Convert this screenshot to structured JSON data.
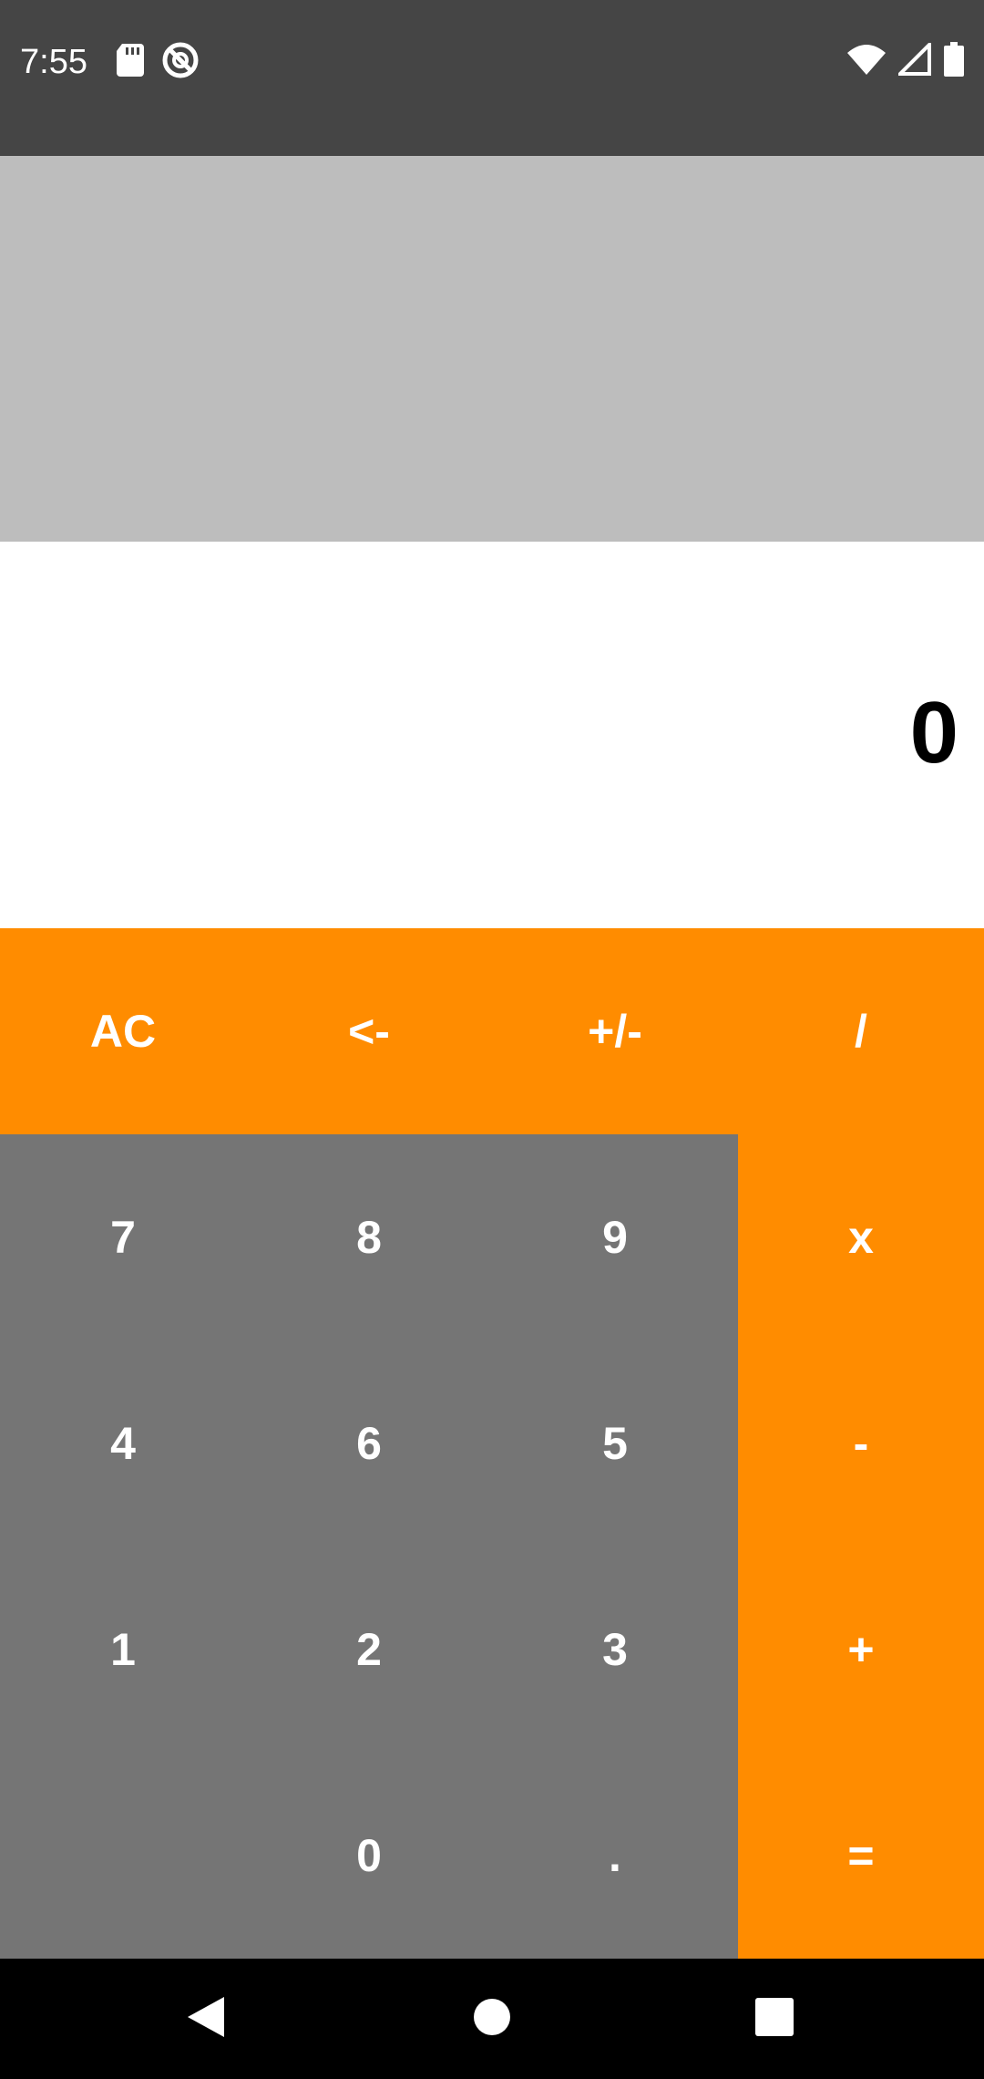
{
  "status_bar": {
    "time": "7:55",
    "left_icons": [
      "sd-card-icon",
      "do-not-disturb-icon"
    ],
    "right_icons": [
      "wifi-icon",
      "cell-signal-icon",
      "battery-icon"
    ]
  },
  "display": {
    "history": "",
    "result": "0"
  },
  "keys": {
    "clear": "AC",
    "backspace": "<-",
    "sign": "+/-",
    "divide": "/",
    "seven": "7",
    "eight": "8",
    "nine": "9",
    "multiply": "x",
    "four": "4",
    "six": "6",
    "five": "5",
    "minus": "-",
    "one": "1",
    "two": "2",
    "three": "3",
    "plus": "+",
    "zero": "0",
    "dot": ".",
    "equals": "="
  },
  "colors": {
    "operator": "#ff8c00",
    "number": "#757575",
    "history_bg": "#bdbdbd",
    "status_bar": "#454545"
  },
  "nav_bar": {
    "buttons": [
      "back-icon",
      "home-icon",
      "recents-icon"
    ]
  }
}
